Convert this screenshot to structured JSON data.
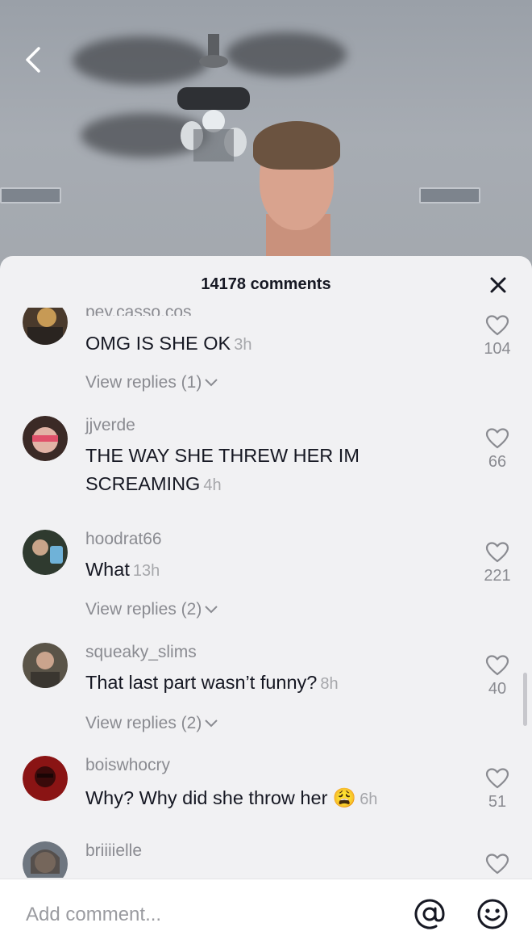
{
  "header": {
    "title": "14178 comments"
  },
  "comments": [
    {
      "username": "pey.casso.cos",
      "text": "OMG IS SHE OK",
      "time": "3h",
      "likes": "104",
      "replies": "View replies (1)",
      "avatar_color": "#4a3a2c"
    },
    {
      "username": "jjverde",
      "text": "THE WAY SHE THREW HER IM SCREAMING",
      "time": "4h",
      "likes": "66",
      "replies": "",
      "avatar_color": "#c86b6b"
    },
    {
      "username": "hoodrat66",
      "text": "What",
      "time": "13h",
      "likes": "221",
      "replies": "View replies (2)",
      "avatar_color": "#2f3a2f"
    },
    {
      "username": "squeaky_slims",
      "text": "That last part wasn’t funny?",
      "time": "8h",
      "likes": "40",
      "replies": "View replies (2)",
      "avatar_color": "#5a5448"
    },
    {
      "username": "boiswhocry",
      "text": "Why? Why did she throw her 😩",
      "time": "6h",
      "likes": "51",
      "replies": "",
      "avatar_color": "#8a1414"
    },
    {
      "username": "briiiielle",
      "text": "",
      "time": "",
      "likes": "",
      "replies": "",
      "avatar_color": "#6e7680"
    }
  ],
  "input": {
    "placeholder": "Add comment..."
  },
  "icons": {
    "back": "chevron-left-icon",
    "close": "close-icon",
    "like": "heart-outline-icon",
    "mention": "at-sign-icon",
    "emoji": "smiley-icon"
  },
  "colors": {
    "sheet_bg": "#f1f1f3",
    "text_primary": "#161823",
    "text_secondary": "#8a8b91"
  }
}
